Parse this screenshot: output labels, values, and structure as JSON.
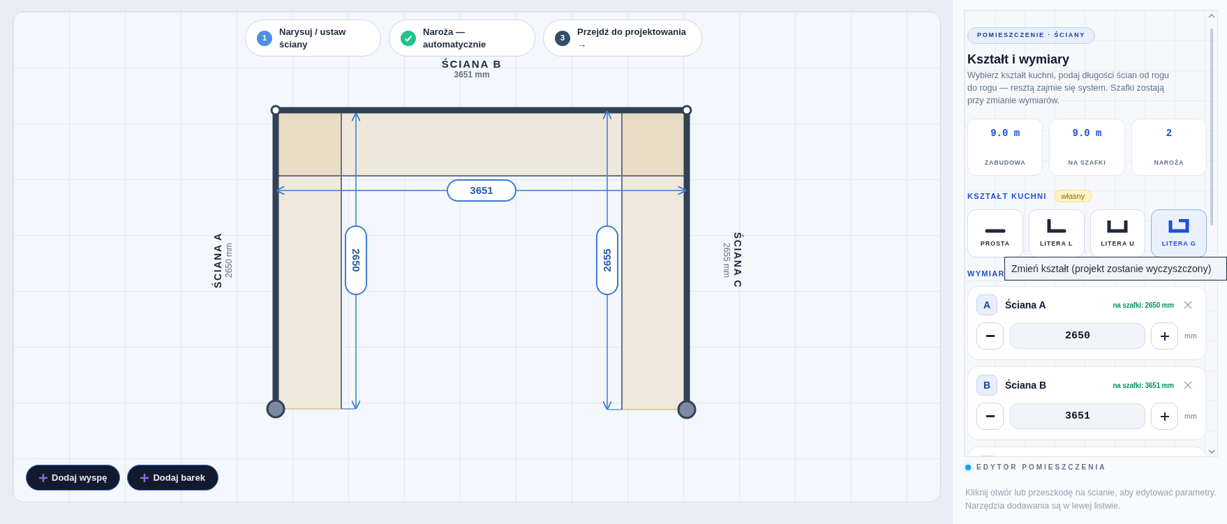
{
  "steps": [
    {
      "kind": "current",
      "number": "1",
      "label": "Narysuj / ustaw ściany"
    },
    {
      "kind": "done",
      "label": "Naroża — automatycznie"
    },
    {
      "kind": "pending",
      "number": "3",
      "label": "Przejdź do projektowania →"
    }
  ],
  "walls": [
    {
      "name": "ŚCIANA A",
      "length": "2650 mm",
      "dimension": "2650"
    },
    {
      "name": "ŚCIANA B",
      "length": "3651 mm",
      "dimension": "3651"
    },
    {
      "name": "ŚCIANA C",
      "length": "2655 mm",
      "dimension": "2655"
    }
  ],
  "actions": [
    {
      "label": "Dodaj wyspę"
    },
    {
      "label": "Dodaj barek"
    }
  ],
  "panel": {
    "badge": "POMIESZCZENIE · ŚCIANY",
    "title": "Kształt i wymiary",
    "description": "Wybierz kształt kuchni, podaj długości ścian od rogu do rogu — resztą zajmie się system. Szafki zostają przy zmianie wymiarów.",
    "stats": [
      {
        "value": "9.0 m",
        "label": "ZABUDOWA"
      },
      {
        "value": "9.0 m",
        "label": "NA SZAFKI"
      },
      {
        "value": "2",
        "label": "NAROŻA"
      }
    ],
    "shape_heading": "KSZTAŁT KUCHNI",
    "shape_badge": "własny",
    "shapes": [
      {
        "kind": "straight",
        "label": "PROSTA",
        "selected": false
      },
      {
        "kind": "l",
        "label": "LITERA L",
        "selected": false
      },
      {
        "kind": "u",
        "label": "LITERA U",
        "selected": false
      },
      {
        "kind": "g",
        "label": "LITERA G",
        "selected": true
      }
    ],
    "dimensions_heading": "WYMIAR",
    "wall_cards": [
      {
        "letter": "A",
        "name": "Ściana A",
        "note": "na szafki: 2650 mm",
        "value": "2650",
        "unit": "mm"
      },
      {
        "letter": "B",
        "name": "Ściana B",
        "note": "na szafki: 3651 mm",
        "value": "3651",
        "unit": "mm"
      }
    ],
    "tooltip": "Zmień kształt (projekt zostanie wyczyszczony)",
    "footer": {
      "title": "EDYTOR POMIESZCZENIA",
      "text": "Kliknij otwór lub przeszkodę na ścianie, aby edytować parametry. Narzędzia dodawania są w lewej listwie."
    }
  }
}
